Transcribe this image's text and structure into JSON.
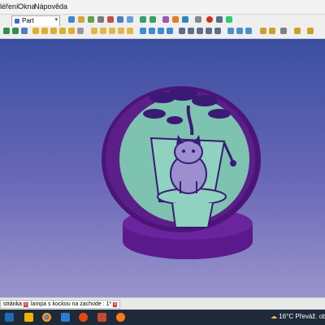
{
  "menu": {
    "items": [
      "léření",
      "Okna",
      "Nápověda"
    ]
  },
  "workbench": {
    "value": "Part"
  },
  "tabs": [
    {
      "label": "stránka"
    },
    {
      "label": "lampa s kockou na zachode : 1*"
    }
  ],
  "status": {
    "temperature": "16°C",
    "weather_text": "Převáž. oblač"
  },
  "colors": {
    "model_body": "#5c1f8a",
    "model_base": "#5b1a8c",
    "medallion": "#7ec2b0",
    "engraving": "#3b1a75",
    "taskbar": "#1e2a3a"
  }
}
